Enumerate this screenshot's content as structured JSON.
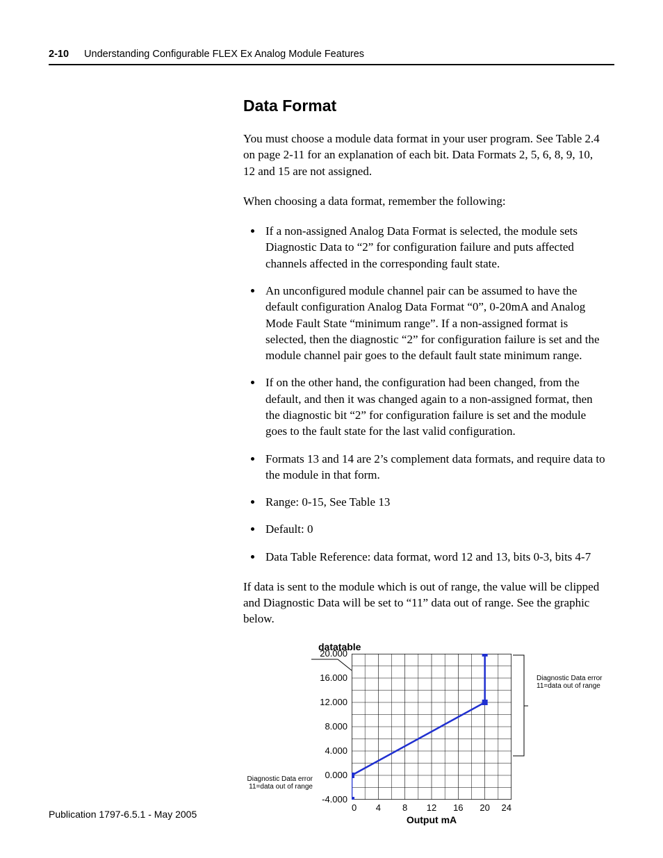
{
  "header": {
    "page_number": "2-10",
    "chapter_title": "Understanding Configurable FLEX Ex Analog Module Features"
  },
  "section": {
    "title": "Data Format",
    "p1": "You must choose a module data format in your user program. See Table 2.4 on page 2-11 for an explanation of each bit. Data Formats 2, 5, 6, 8, 9, 10, 12 and 15 are not assigned.",
    "p2": "When choosing a data format, remember the following:",
    "bullets": [
      "If a non-assigned Analog Data Format is selected, the module sets Diagnostic Data to “2” for configuration failure and puts affected channels affected in the corresponding fault state.",
      "An unconfigured module channel pair can be assumed to have the default configuration Analog Data Format “0”, 0-20mA and Analog Mode Fault State “minimum range”. If a non-assigned format is selected, then the diagnostic “2” for configuration failure is set and the module channel pair goes to the default fault state minimum range.",
      "If on the other hand, the configuration had been changed, from the default, and then it was changed again to a non-assigned format, then the diagnostic bit “2” for configuration failure is set and the module goes to the fault state for the last valid configuration.",
      "Formats 13 and 14 are 2’s complement data formats, and require data to the module in that form.",
      "Range: 0-15, See Table 13",
      "Default: 0",
      "Data Table Reference: data format, word 12 and 13, bits 0-3, bits 4-7"
    ],
    "p3": "If data is sent to the module which is out of range, the value will be clipped and Diagnostic Data will be set to “11” data out of range. See the graphic below."
  },
  "footer": {
    "publication": "Publication 1797-6.5.1 - May 2005"
  },
  "chart_data": {
    "type": "line",
    "title": "datatable",
    "xlabel": "Output mA",
    "ylabel": "",
    "x_ticks": [
      0,
      4,
      8,
      12,
      16,
      20,
      24
    ],
    "y_ticks": [
      -4.0,
      0.0,
      4.0,
      8.0,
      12.0,
      16.0,
      20.0
    ],
    "xlim": [
      0,
      24
    ],
    "ylim": [
      -4,
      20
    ],
    "series": [
      {
        "name": "datatable",
        "points": [
          {
            "x": 0,
            "y": -4
          },
          {
            "x": 0,
            "y": 0
          },
          {
            "x": 20,
            "y": 12
          },
          {
            "x": 20,
            "y": 20
          }
        ]
      }
    ],
    "annotations": {
      "left": {
        "line1": "Diagnostic Data error",
        "line2": "11=data out of range"
      },
      "right": {
        "line1": "Diagnostic Data error",
        "line2": "11=data out of range"
      }
    }
  }
}
